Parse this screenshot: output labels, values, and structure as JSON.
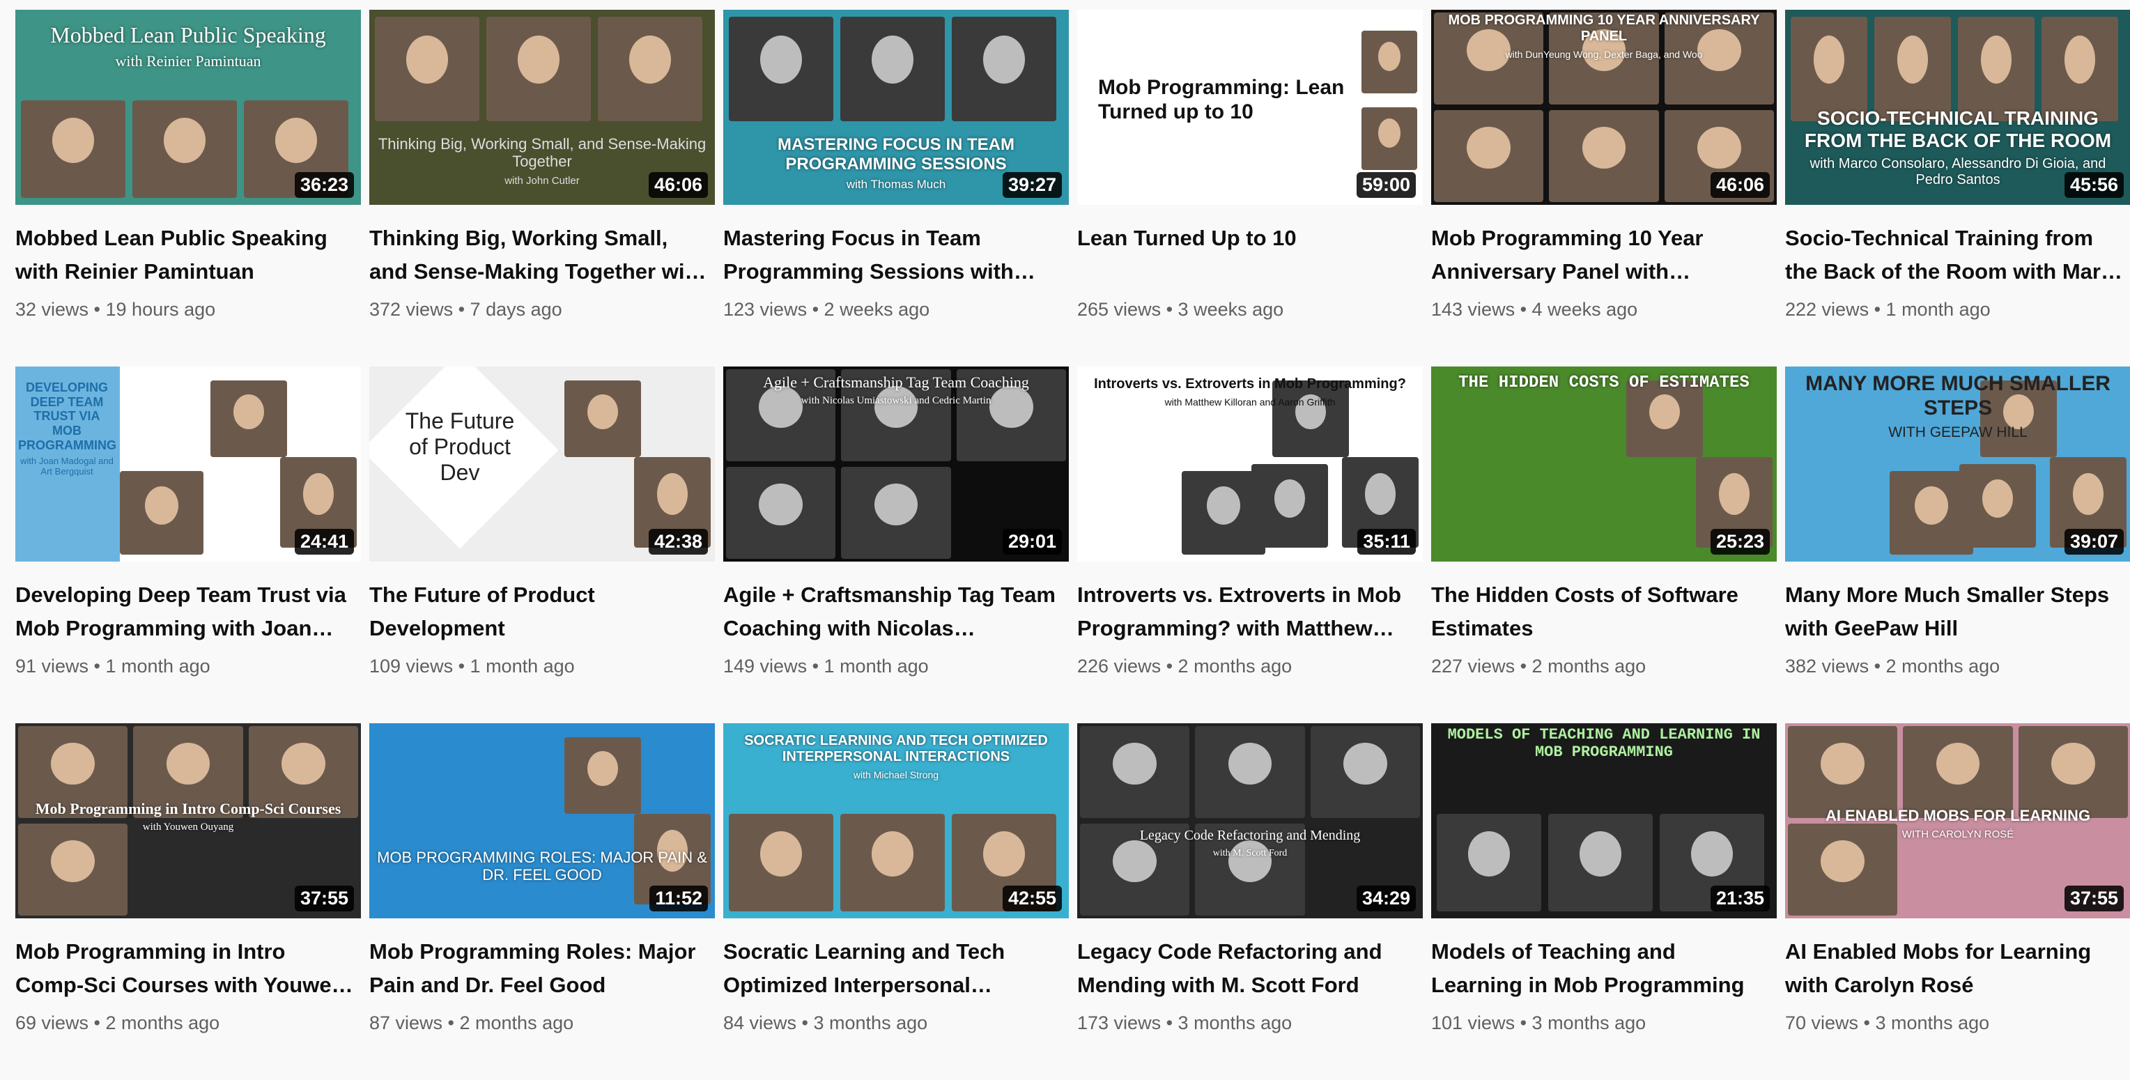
{
  "videos": [
    {
      "title": "Mobbed Lean Public Speaking with Reinier Pamintuan",
      "views": "32 views",
      "age": "19 hours ago",
      "duration": "36:23",
      "thumb_text": [
        "Mobbed Lean Public Speaking",
        "with Reinier Pamintuan"
      ],
      "bg": "#3e9486"
    },
    {
      "title": "Thinking Big, Working Small, and Sense-Making Together with John Cutler",
      "views": "372 views",
      "age": "7 days ago",
      "duration": "46:06",
      "thumb_text": [
        "Thinking Big, Working Small, and Sense-Making Together",
        "with John Cutler"
      ],
      "bg": "#4a4f2e"
    },
    {
      "title": "Mastering Focus in Team Programming Sessions with Thomas Much",
      "views": "123 views",
      "age": "2 weeks ago",
      "duration": "39:27",
      "thumb_text": [
        "MASTERING FOCUS IN TEAM PROGRAMMING SESSIONS",
        "with Thomas Much"
      ],
      "bg": "#2f95a8"
    },
    {
      "title": "Lean Turned Up to 10",
      "views": "265 views",
      "age": "3 weeks ago",
      "duration": "59:00",
      "thumb_text": [
        "Mob Programming: Lean Turned up to 10"
      ],
      "bg": "#ffffff"
    },
    {
      "title": "Mob Programming 10 Year Anniversary Panel with DunYeung Wong, Dexter Baga, and Woody Zuill",
      "views": "143 views",
      "age": "4 weeks ago",
      "duration": "46:06",
      "thumb_text": [
        "MOB PROGRAMMING 10 YEAR ANNIVERSARY PANEL",
        "with DunYeung Wong, Dexter Baga, and Woo"
      ],
      "bg": "#111111"
    },
    {
      "title": "Socio-Technical Training from the Back of the Room with Marco Consolaro",
      "views": "222 views",
      "age": "1 month ago",
      "duration": "45:56",
      "thumb_text": [
        "SOCIO-TECHNICAL TRAINING FROM THE BACK OF THE ROOM",
        "with Marco Consolaro, Alessandro Di Gioia, and Pedro Santos"
      ],
      "bg": "#1e5a5a"
    },
    {
      "title": "Developing Deep Team Trust via Mob Programming with Joan Madogal and Art Bergquist",
      "views": "91 views",
      "age": "1 month ago",
      "duration": "24:41",
      "thumb_text": [
        "DEVELOPING DEEP TEAM TRUST VIA MOB PROGRAMMING",
        "with Joan Madogal and Art Bergquist"
      ],
      "bg": "#ffffff"
    },
    {
      "title": "The Future of Product Development",
      "views": "109 views",
      "age": "1 month ago",
      "duration": "42:38",
      "thumb_text": [
        "The Future of Product Dev"
      ],
      "bg": "#eeeeee"
    },
    {
      "title": "Agile + Craftsmanship Tag Team Coaching with Nicolas Umiastowski and Cedric Martin",
      "views": "149 views",
      "age": "1 month ago",
      "duration": "29:01",
      "thumb_text": [
        "Agile + Craftsmanship Tag Team Coaching",
        "with Nicolas Umiastowski and Cedric Martin"
      ],
      "bg": "#0d0d0d"
    },
    {
      "title": "Introverts vs. Extroverts in Mob Programming? with Matthew Killoran and Aaron Griffith",
      "views": "226 views",
      "age": "2 months ago",
      "duration": "35:11",
      "thumb_text": [
        "Introverts vs. Extroverts in Mob Programming?",
        "with Matthew Killoran and Aaron Griffith"
      ],
      "bg": "#ffffff"
    },
    {
      "title": "The Hidden Costs of Software Estimates",
      "views": "227 views",
      "age": "2 months ago",
      "duration": "25:23",
      "thumb_text": [
        "THE HIDDEN COSTS OF ESTIMATES"
      ],
      "bg": "#4a8a2a"
    },
    {
      "title": "Many More Much Smaller Steps with GeePaw Hill",
      "views": "382 views",
      "age": "2 months ago",
      "duration": "39:07",
      "thumb_text": [
        "MANY MORE MUCH SMALLER STEPS",
        "WITH GEEPAW HILL"
      ],
      "bg": "#4fa8d8"
    },
    {
      "title": "Mob Programming in Intro Comp-Sci Courses with Youwen Ouyang",
      "views": "69 views",
      "age": "2 months ago",
      "duration": "37:55",
      "thumb_text": [
        "Mob Programming in Intro Comp-Sci Courses",
        "with Youwen Ouyang"
      ],
      "bg": "#2a2a2a"
    },
    {
      "title": "Mob Programming Roles: Major Pain and Dr. Feel Good",
      "views": "87 views",
      "age": "2 months ago",
      "duration": "11:52",
      "thumb_text": [
        "MOB PROGRAMMING ROLES: MAJOR PAIN & DR. FEEL GOOD"
      ],
      "bg": "#2a8ccf"
    },
    {
      "title": "Socratic Learning and Tech Optimized Interpersonal Interactions",
      "views": "84 views",
      "age": "3 months ago",
      "duration": "42:55",
      "thumb_text": [
        "SOCRATIC LEARNING AND TECH OPTIMIZED INTERPERSONAL INTERACTIONS",
        "with Michael Strong"
      ],
      "bg": "#3ab0d0"
    },
    {
      "title": "Legacy Code Refactoring and Mending with M. Scott Ford",
      "views": "173 views",
      "age": "3 months ago",
      "duration": "34:29",
      "thumb_text": [
        "Legacy Code Refactoring and Mending",
        "with M. Scott Ford"
      ],
      "bg": "#222222"
    },
    {
      "title": "Models of Teaching and Learning in Mob Programming",
      "views": "101 views",
      "age": "3 months ago",
      "duration": "21:35",
      "thumb_text": [
        "MODELS OF TEACHING AND LEARNING IN MOB PROGRAMMING"
      ],
      "bg": "#1a1a1a"
    },
    {
      "title": "AI Enabled Mobs for Learning with Carolyn Rosé",
      "views": "70 views",
      "age": "3 months ago",
      "duration": "37:55",
      "thumb_text": [
        "AI ENABLED MOBS FOR LEARNING",
        "WITH CAROLYN ROSÉ"
      ],
      "bg": "#c98fa0"
    }
  ]
}
